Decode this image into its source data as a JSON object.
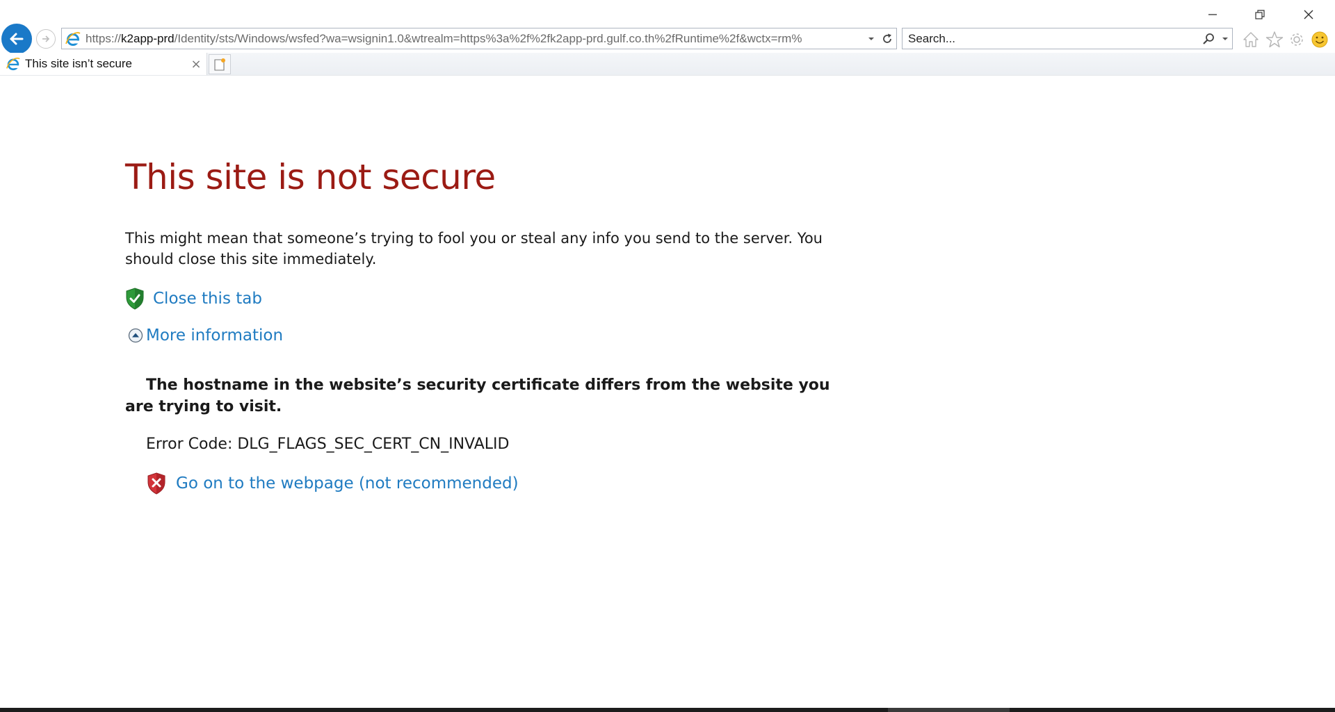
{
  "browser": {
    "address": {
      "url_prefix": "https://",
      "url_host": "k2app-prd",
      "url_rest": "/Identity/sts/Windows/wsfed?wa=wsignin1.0&wtrealm=https%3a%2f%2fk2app-prd.gulf.co.th%2fRuntime%2f&wctx=rm%"
    },
    "search": {
      "placeholder": "Search..."
    },
    "tab": {
      "title": "This site isn’t secure",
      "close_glyph": "×"
    },
    "icons": [
      "back-icon",
      "forward-icon",
      "ie-logo-icon",
      "dropdown-icon",
      "refresh-icon",
      "search-icon",
      "home-icon",
      "favorites-star-icon",
      "settings-gear-icon",
      "smiley-feedback-icon",
      "minimize-icon",
      "restore-icon",
      "close-icon",
      "new-tab-icon"
    ],
    "colors": {
      "back_button": "#1a79c8",
      "headline": "#9b1b14",
      "link": "#1f7bc1"
    }
  },
  "page": {
    "headline": "This site is not secure",
    "description": "This might mean that someone’s trying to fool you or steal any info you send to the server. You should close this site immediately.",
    "close_tab_link": "Close this tab",
    "more_info_link": "More information",
    "detail": "The hostname in the website’s security certificate differs from the website you are trying to visit.",
    "error_code": "Error Code: DLG_FLAGS_SEC_CERT_CN_INVALID",
    "go_on_link": "Go on to the webpage (not recommended)"
  }
}
